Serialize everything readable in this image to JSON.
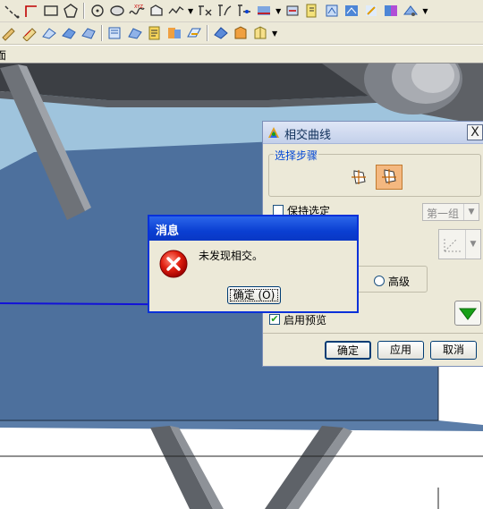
{
  "toolbar_top": {
    "icons": [
      "sketch-points-icon",
      "arc-icon",
      "rectangle-icon",
      "polygon-icon",
      "circle-icon",
      "ellipse-icon",
      "spline-icon",
      "xyz-point-icon",
      "offset-curve-icon",
      "curve-network-icon",
      "trim-curve-icon",
      "fillet-curve-icon",
      "bridge-curve-icon",
      "project-curve-icon",
      "blend-icon",
      "extract-curve-icon",
      "section-curve-icon",
      "join-icon",
      "combined-projection-icon",
      "wrap-icon",
      "isoparametric-icon"
    ]
  },
  "toolbar_second": {
    "icons": [
      "edit-curve-icon",
      "curve-length-icon",
      "smooth-spline-icon",
      "show-poles-icon",
      "hide-poles-icon",
      "curvature-comb-icon",
      "analyze-curve-icon",
      "points-tool-icon",
      "deviation-icon",
      "offset-face-icon",
      "freeform-icon",
      "surface-check-icon"
    ]
  },
  "statusbar": {
    "text": "面"
  },
  "curve_dialog": {
    "title": "相交曲线",
    "close_label": "X",
    "steps_label": "选择步骤",
    "keep_selected_label": "保持选定",
    "set_combo": "第一组",
    "advanced_label": "高级",
    "enable_preview_label": "启用预览",
    "ok_label": "确定",
    "apply_label": "应用",
    "cancel_label": "取消"
  },
  "message_box": {
    "title": "消息",
    "message": "未发现相交。",
    "ok_label": "确定 (O)"
  },
  "colors": {
    "face_blue": "#4d709d",
    "sky": "#9fc4dd",
    "xp_title_blue": "#0a3fd2",
    "error_red": "#d00000",
    "preview_green": "#18a018"
  }
}
